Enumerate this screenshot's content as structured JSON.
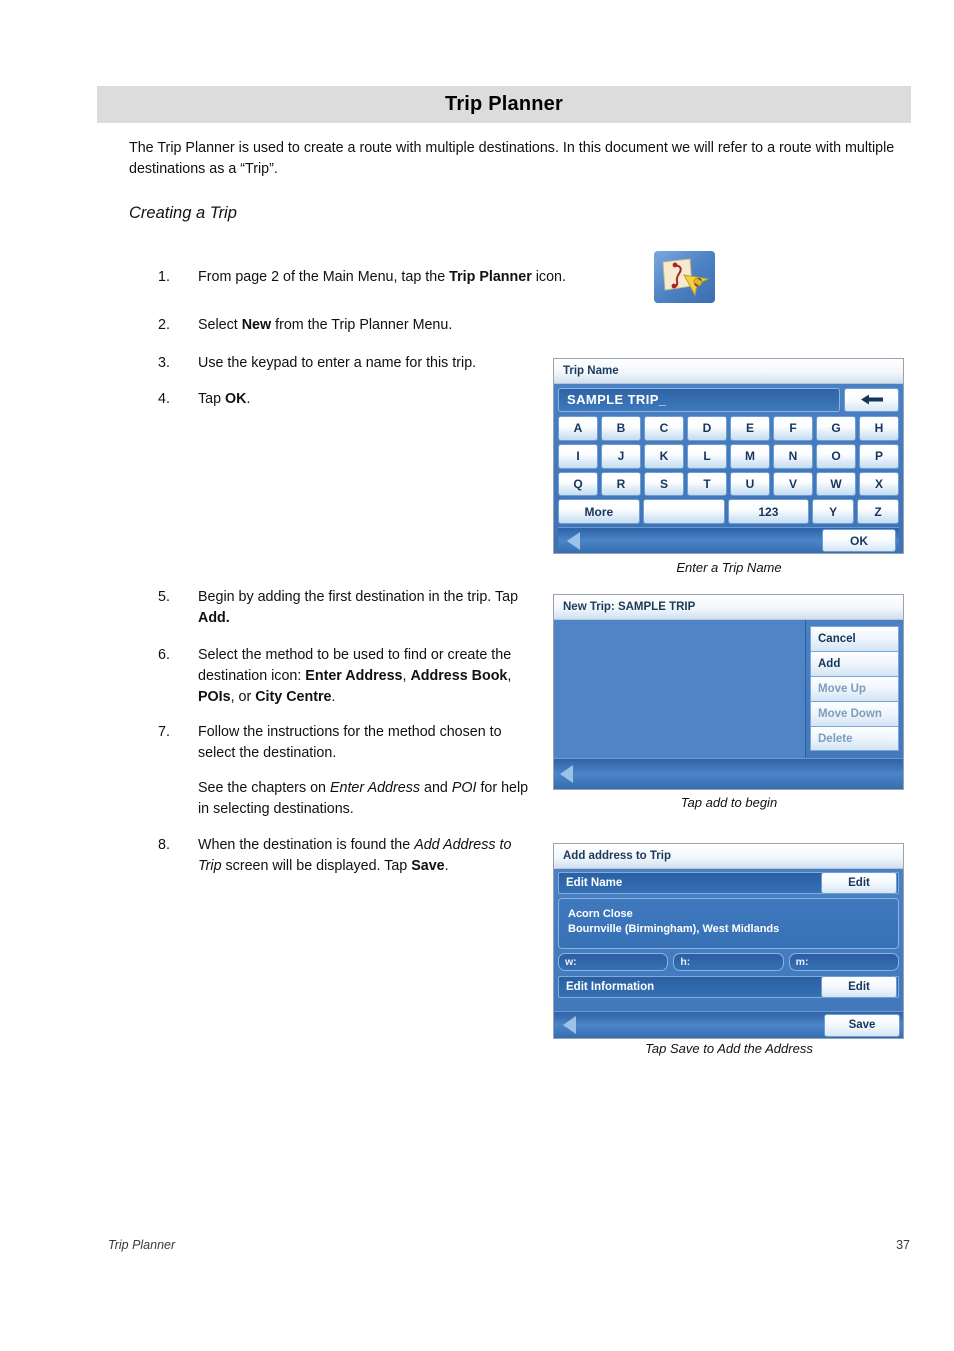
{
  "chapter": {
    "title": "Trip Planner"
  },
  "intro": {
    "paragraph": "The Trip Planner is used to create a route with multiple destinations.  In this document we will refer to a route with multiple destinations as a “Trip”."
  },
  "section": {
    "heading": "Creating a Trip"
  },
  "steps": [
    {
      "num": "1.",
      "html": "From page 2 of the Main Menu, tap the <b>Trip Planner</b> icon."
    },
    {
      "num": "2.",
      "html": "Select <b>New</b> from the Trip Planner Menu."
    },
    {
      "num": "3.",
      "html": "Use the keypad to enter a name for this trip."
    },
    {
      "num": "4.",
      "html": "Tap <b>OK</b>."
    },
    {
      "num": "5.",
      "html": "Begin by adding the first destination in the trip.  Tap <b>Add.</b>"
    },
    {
      "num": "6.",
      "html": "Select the method to be used to find or create the destination icon: <b>Enter Address</b>, <b>Address Book</b>, <b>POIs</b>, or <b>City Centre</b>."
    },
    {
      "num": "7.",
      "html": "Follow the instructions for the method chosen to select the destination."
    },
    {
      "num": "",
      "html": "See the chapters on <i>Enter Address</i> and <i>POI</i> for help in selecting destinations."
    },
    {
      "num": "8.",
      "html": "When the destination is found the <i>Add Address to Trip</i> screen will be displayed. Tap <b>Save</b>."
    }
  ],
  "app_icon": {
    "name": "Trip Planner",
    "background_color": "#4a7fc1",
    "card_color": "#f4e7c8",
    "route_color": "#b02020",
    "arrow_color": "#f5d24a"
  },
  "screenshot_trip_name": {
    "title": "Trip Name",
    "input_value": "SAMPLE TRIP_",
    "backspace_label": "←",
    "keys_row1": [
      "A",
      "B",
      "C",
      "D",
      "E",
      "F",
      "G",
      "H"
    ],
    "keys_row2": [
      "I",
      "J",
      "K",
      "L",
      "M",
      "N",
      "O",
      "P"
    ],
    "keys_row3": [
      "Q",
      "R",
      "S",
      "T",
      "U",
      "V",
      "W",
      "X"
    ],
    "keys_row4": [
      "More",
      "",
      "123",
      "Y",
      "Z"
    ],
    "ok_label": "OK",
    "caption": "Enter a Trip Name"
  },
  "screenshot_new_trip": {
    "title": "New Trip: SAMPLE TRIP",
    "menu": [
      {
        "label": "Cancel",
        "enabled": true
      },
      {
        "label": "Add",
        "enabled": true
      },
      {
        "label": "Move Up",
        "enabled": false
      },
      {
        "label": "Move Down",
        "enabled": false
      },
      {
        "label": "Delete",
        "enabled": false
      }
    ],
    "caption": "Tap add to begin"
  },
  "screenshot_add_address": {
    "title": "Add address to Trip",
    "edit_name_label": "Edit Name",
    "edit_name_button": "Edit",
    "address_line1": "Acorn Close",
    "address_line2": "Bournville (Birmingham), West Midlands",
    "field_w": "w:",
    "field_h": "h:",
    "field_m": "m:",
    "edit_information_label": "Edit Information",
    "edit_information_button": "Edit",
    "save_label": "Save",
    "caption": "Tap Save to Add the Address"
  },
  "footer": {
    "left": "Trip Planner",
    "page_number": "37"
  },
  "colors": {
    "header_bar": "#dcdcdc",
    "device_blue": "#3f76bb",
    "device_key": "#e4eff9",
    "disabled_text": "#7e9cbd"
  }
}
